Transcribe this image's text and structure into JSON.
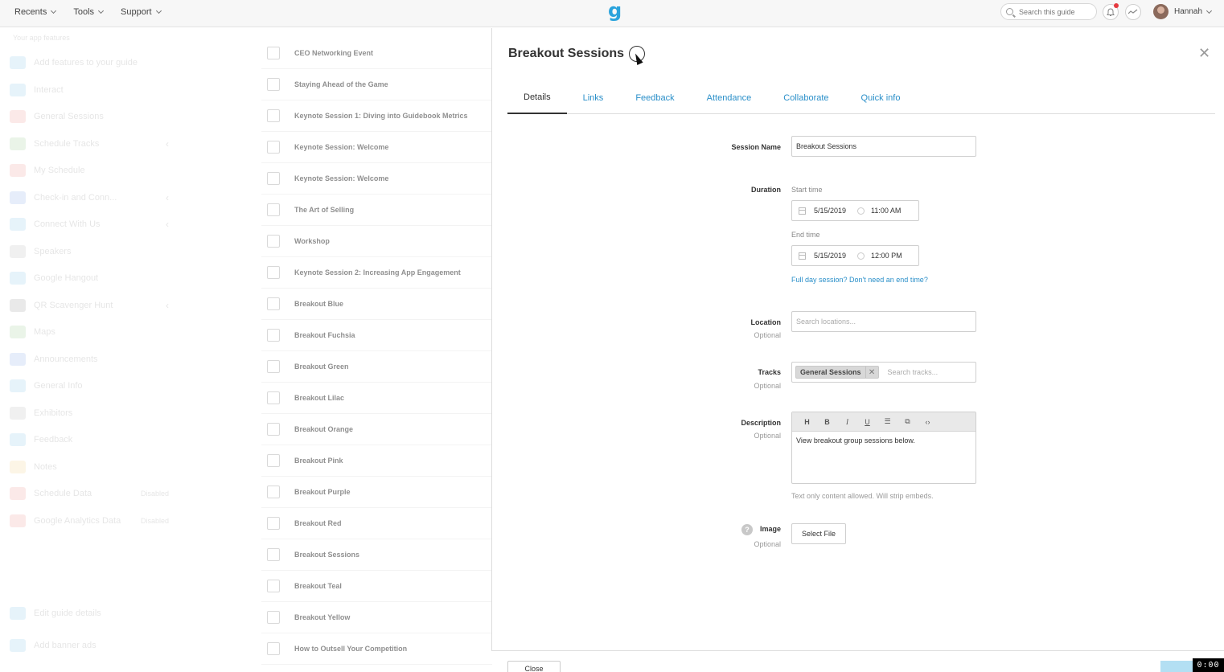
{
  "topbar": {
    "nav": [
      {
        "label": "Recents"
      },
      {
        "label": "Tools"
      },
      {
        "label": "Support"
      }
    ],
    "logo": "g",
    "search_placeholder": "Search this guide",
    "username": "Hannah"
  },
  "sidebar": {
    "header": "Your app features",
    "items": [
      {
        "label": "Add features to your guide",
        "color": "#3aa0d8"
      },
      {
        "label": "Interact",
        "color": "#3aa0d8"
      },
      {
        "label": "General Sessions",
        "color": "#e0534a"
      },
      {
        "label": "Schedule Tracks",
        "color": "#5aa84b",
        "chevron": true
      },
      {
        "label": "My Schedule",
        "color": "#e0534a"
      },
      {
        "label": "Check-in and Conn...",
        "color": "#3a6fd8",
        "chevron": true
      },
      {
        "label": "Connect With Us",
        "color": "#3aa0d8",
        "chevron": true
      },
      {
        "label": "Speakers",
        "color": "#888888"
      },
      {
        "label": "Google Hangout",
        "color": "#3aa0d8"
      },
      {
        "label": "QR Scavenger Hunt",
        "color": "#555555",
        "chevron": true
      },
      {
        "label": "Maps",
        "color": "#5aa84b"
      },
      {
        "label": "Announcements",
        "color": "#3a6fd8"
      },
      {
        "label": "General Info",
        "color": "#3aa0d8"
      },
      {
        "label": "Exhibitors",
        "color": "#888888"
      },
      {
        "label": "Feedback",
        "color": "#3aa0d8"
      },
      {
        "label": "Notes",
        "color": "#e8b23a"
      },
      {
        "label": "Schedule Data",
        "color": "#e0534a",
        "muted": "Disabled"
      },
      {
        "label": "Google Analytics Data",
        "color": "#e0534a",
        "muted": "Disabled"
      }
    ],
    "footer": [
      {
        "label": "Edit guide details"
      },
      {
        "label": "Add banner ads"
      }
    ]
  },
  "sessions": [
    "CEO Networking Event",
    "Staying Ahead of the Game",
    "Keynote Session 1: Diving into Guidebook Metrics",
    "Keynote Session: Welcome",
    "Keynote Session: Welcome",
    "The Art of Selling",
    "Workshop",
    "Keynote Session 2: Increasing App Engagement",
    "Breakout Blue",
    "Breakout Fuchsia",
    "Breakout Green",
    "Breakout Lilac",
    "Breakout Orange",
    "Breakout Pink",
    "Breakout Purple",
    "Breakout Red",
    "Breakout Sessions",
    "Breakout Teal",
    "Breakout Yellow",
    "How to Outsell Your Competition"
  ],
  "panel": {
    "title": "Breakout Sessions",
    "tabs": [
      "Details",
      "Links",
      "Feedback",
      "Attendance",
      "Collaborate",
      "Quick info"
    ],
    "form": {
      "session_name_label": "Session Name",
      "session_name_value": "Breakout Sessions",
      "duration_label": "Duration",
      "start_label": "Start time",
      "start_date": "5/15/2019",
      "start_time": "11:00 AM",
      "end_label": "End time",
      "end_date": "5/15/2019",
      "end_time": "12:00 PM",
      "full_day_link": "Full day session? Don't need an end time?",
      "location_label": "Location",
      "optional": "Optional",
      "location_placeholder": "Search locations...",
      "tracks_label": "Tracks",
      "track_tag": "General Sessions",
      "tracks_placeholder": "Search tracks...",
      "description_label": "Description",
      "description_value": "View breakout group sessions below.",
      "description_helper": "Text only content allowed. Will strip embeds.",
      "image_label": "Image",
      "select_file": "Select File"
    }
  },
  "footer": {
    "close_label": "Close",
    "timer": "0:00"
  }
}
